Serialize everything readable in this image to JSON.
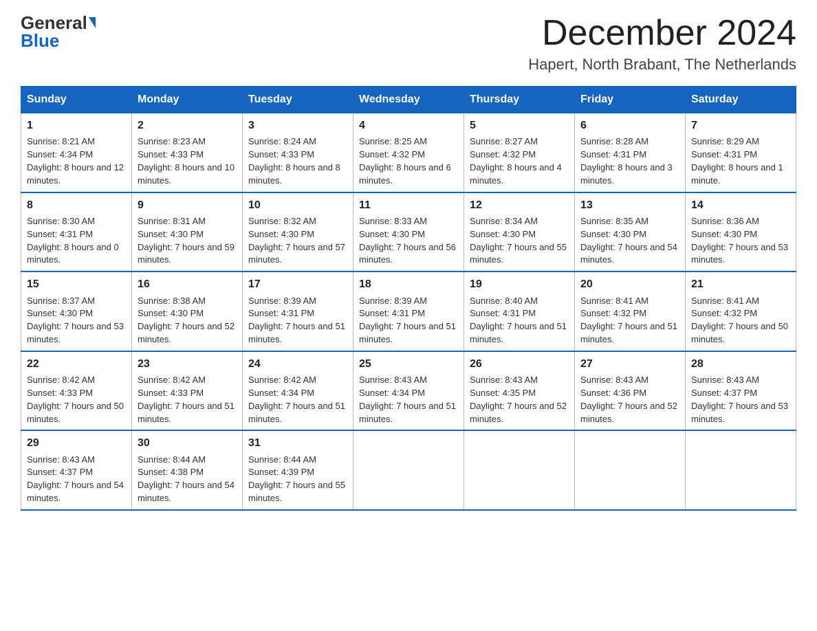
{
  "header": {
    "logo_general": "General",
    "logo_blue": "Blue",
    "month_title": "December 2024",
    "location": "Hapert, North Brabant, The Netherlands"
  },
  "days_of_week": [
    "Sunday",
    "Monday",
    "Tuesday",
    "Wednesday",
    "Thursday",
    "Friday",
    "Saturday"
  ],
  "weeks": [
    [
      {
        "day": "1",
        "sunrise": "8:21 AM",
        "sunset": "4:34 PM",
        "daylight": "8 hours and 12 minutes."
      },
      {
        "day": "2",
        "sunrise": "8:23 AM",
        "sunset": "4:33 PM",
        "daylight": "8 hours and 10 minutes."
      },
      {
        "day": "3",
        "sunrise": "8:24 AM",
        "sunset": "4:33 PM",
        "daylight": "8 hours and 8 minutes."
      },
      {
        "day": "4",
        "sunrise": "8:25 AM",
        "sunset": "4:32 PM",
        "daylight": "8 hours and 6 minutes."
      },
      {
        "day": "5",
        "sunrise": "8:27 AM",
        "sunset": "4:32 PM",
        "daylight": "8 hours and 4 minutes."
      },
      {
        "day": "6",
        "sunrise": "8:28 AM",
        "sunset": "4:31 PM",
        "daylight": "8 hours and 3 minutes."
      },
      {
        "day": "7",
        "sunrise": "8:29 AM",
        "sunset": "4:31 PM",
        "daylight": "8 hours and 1 minute."
      }
    ],
    [
      {
        "day": "8",
        "sunrise": "8:30 AM",
        "sunset": "4:31 PM",
        "daylight": "8 hours and 0 minutes."
      },
      {
        "day": "9",
        "sunrise": "8:31 AM",
        "sunset": "4:30 PM",
        "daylight": "7 hours and 59 minutes."
      },
      {
        "day": "10",
        "sunrise": "8:32 AM",
        "sunset": "4:30 PM",
        "daylight": "7 hours and 57 minutes."
      },
      {
        "day": "11",
        "sunrise": "8:33 AM",
        "sunset": "4:30 PM",
        "daylight": "7 hours and 56 minutes."
      },
      {
        "day": "12",
        "sunrise": "8:34 AM",
        "sunset": "4:30 PM",
        "daylight": "7 hours and 55 minutes."
      },
      {
        "day": "13",
        "sunrise": "8:35 AM",
        "sunset": "4:30 PM",
        "daylight": "7 hours and 54 minutes."
      },
      {
        "day": "14",
        "sunrise": "8:36 AM",
        "sunset": "4:30 PM",
        "daylight": "7 hours and 53 minutes."
      }
    ],
    [
      {
        "day": "15",
        "sunrise": "8:37 AM",
        "sunset": "4:30 PM",
        "daylight": "7 hours and 53 minutes."
      },
      {
        "day": "16",
        "sunrise": "8:38 AM",
        "sunset": "4:30 PM",
        "daylight": "7 hours and 52 minutes."
      },
      {
        "day": "17",
        "sunrise": "8:39 AM",
        "sunset": "4:31 PM",
        "daylight": "7 hours and 51 minutes."
      },
      {
        "day": "18",
        "sunrise": "8:39 AM",
        "sunset": "4:31 PM",
        "daylight": "7 hours and 51 minutes."
      },
      {
        "day": "19",
        "sunrise": "8:40 AM",
        "sunset": "4:31 PM",
        "daylight": "7 hours and 51 minutes."
      },
      {
        "day": "20",
        "sunrise": "8:41 AM",
        "sunset": "4:32 PM",
        "daylight": "7 hours and 51 minutes."
      },
      {
        "day": "21",
        "sunrise": "8:41 AM",
        "sunset": "4:32 PM",
        "daylight": "7 hours and 50 minutes."
      }
    ],
    [
      {
        "day": "22",
        "sunrise": "8:42 AM",
        "sunset": "4:33 PM",
        "daylight": "7 hours and 50 minutes."
      },
      {
        "day": "23",
        "sunrise": "8:42 AM",
        "sunset": "4:33 PM",
        "daylight": "7 hours and 51 minutes."
      },
      {
        "day": "24",
        "sunrise": "8:42 AM",
        "sunset": "4:34 PM",
        "daylight": "7 hours and 51 minutes."
      },
      {
        "day": "25",
        "sunrise": "8:43 AM",
        "sunset": "4:34 PM",
        "daylight": "7 hours and 51 minutes."
      },
      {
        "day": "26",
        "sunrise": "8:43 AM",
        "sunset": "4:35 PM",
        "daylight": "7 hours and 52 minutes."
      },
      {
        "day": "27",
        "sunrise": "8:43 AM",
        "sunset": "4:36 PM",
        "daylight": "7 hours and 52 minutes."
      },
      {
        "day": "28",
        "sunrise": "8:43 AM",
        "sunset": "4:37 PM",
        "daylight": "7 hours and 53 minutes."
      }
    ],
    [
      {
        "day": "29",
        "sunrise": "8:43 AM",
        "sunset": "4:37 PM",
        "daylight": "7 hours and 54 minutes."
      },
      {
        "day": "30",
        "sunrise": "8:44 AM",
        "sunset": "4:38 PM",
        "daylight": "7 hours and 54 minutes."
      },
      {
        "day": "31",
        "sunrise": "8:44 AM",
        "sunset": "4:39 PM",
        "daylight": "7 hours and 55 minutes."
      },
      null,
      null,
      null,
      null
    ]
  ],
  "labels": {
    "sunrise": "Sunrise:",
    "sunset": "Sunset:",
    "daylight": "Daylight:"
  }
}
